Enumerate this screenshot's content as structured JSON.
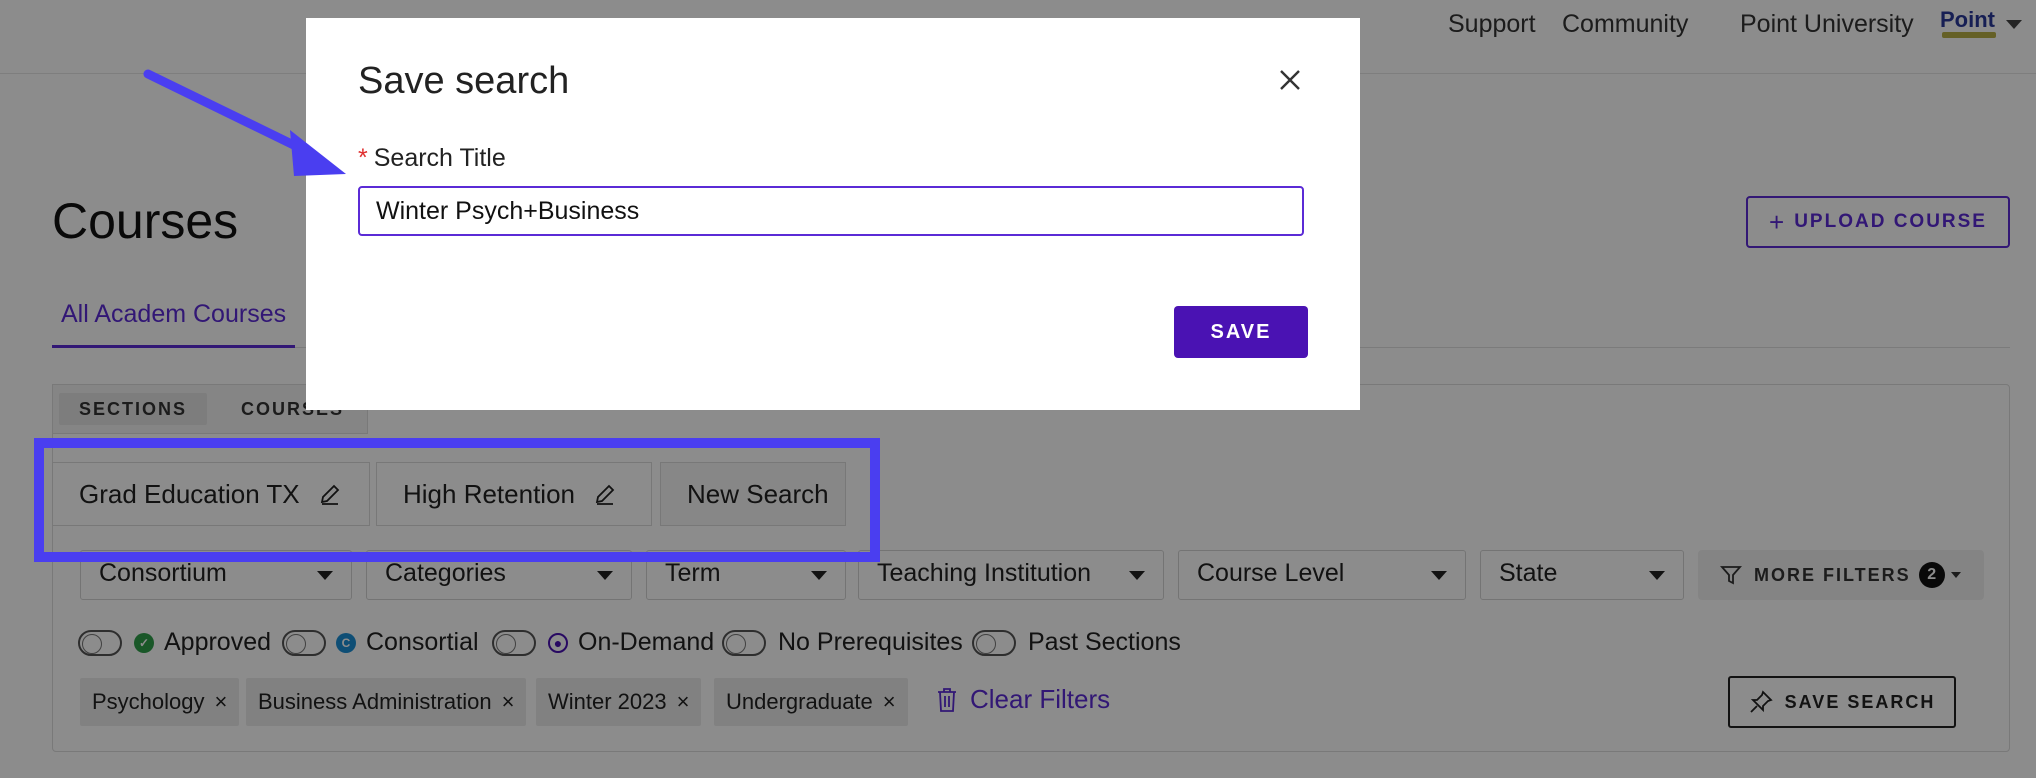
{
  "topnav": {
    "links": [
      "Support",
      "Community",
      "Point University"
    ],
    "logo_text": "Point"
  },
  "page": {
    "title": "Courses",
    "upload_label": "UPLOAD COURSE",
    "tab_active": "All Academ Courses"
  },
  "toggle_view": {
    "sections_label": "SECTIONS",
    "courses_label": "COURSES"
  },
  "saved_searches": [
    {
      "label": "Grad Education TX"
    },
    {
      "label": "High Retention"
    },
    {
      "label": "New Search"
    }
  ],
  "filters": {
    "dropdowns": [
      "Consortium",
      "Categories",
      "Term",
      "Teaching Institution",
      "Course Level",
      "State"
    ],
    "more_filters_label": "MORE FILTERS",
    "more_filters_count": "2"
  },
  "toggles": [
    {
      "label": "Approved",
      "icon": "check-circle-icon",
      "color": "#2e9e4a",
      "glyph": "✓"
    },
    {
      "label": "Consortial",
      "icon": "consortial-c-icon",
      "color": "#1b8fd6",
      "glyph": "C"
    },
    {
      "label": "On-Demand",
      "icon": "on-demand-dot-icon",
      "color": "#4a12b3",
      "glyph": "●"
    },
    {
      "label": "No Prerequisites",
      "icon": "",
      "color": "",
      "glyph": ""
    },
    {
      "label": "Past Sections",
      "icon": "",
      "color": "",
      "glyph": ""
    }
  ],
  "chips": [
    "Psychology",
    "Business Administration",
    "Winter 2023",
    "Undergraduate"
  ],
  "clear_filters_label": "Clear Filters",
  "save_search_label": "SAVE SEARCH",
  "modal": {
    "title": "Save search",
    "field_label": "Search Title",
    "field_value": "Winter Psych+Business",
    "save_label": "SAVE"
  },
  "colors": {
    "accent": "#5b2bd6",
    "annotation": "#4a3ef0",
    "primary_button": "#4a12b3"
  }
}
